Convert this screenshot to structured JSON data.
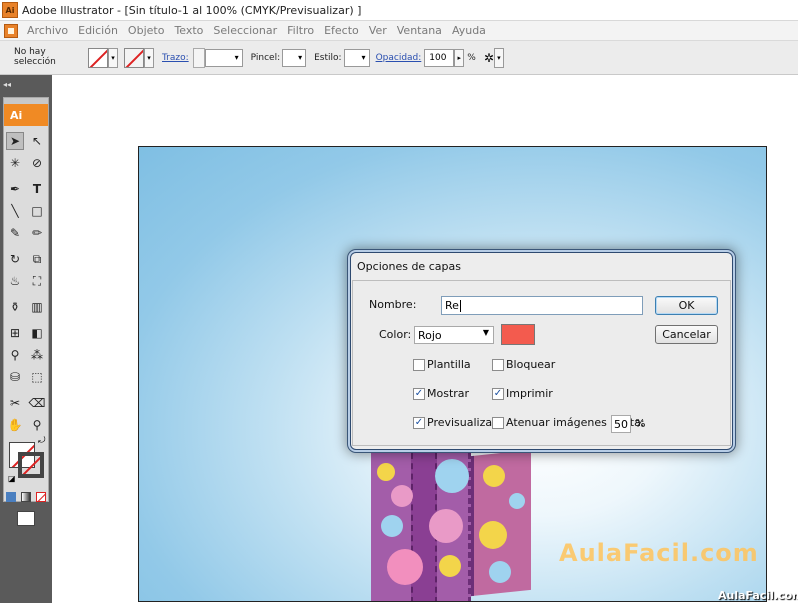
{
  "window": {
    "app_icon_text": "Ai",
    "title": "Adobe Illustrator - [Sin título-1 al 100% (CMYK/Previsualizar) ]"
  },
  "menu": [
    "Archivo",
    "Edición",
    "Objeto",
    "Texto",
    "Seleccionar",
    "Filtro",
    "Efecto",
    "Ver",
    "Ventana",
    "Ayuda"
  ],
  "control_bar": {
    "selection": "No hay selección",
    "trazo_label": "Trazo:",
    "pincel_label": "Pincel:",
    "estilo_label": "Estilo:",
    "opacidad_label": "Opacidad:",
    "opacidad_value": "100",
    "percent": "%"
  },
  "toolbox": {
    "logo": "Ai",
    "collapse": "◂◂"
  },
  "dialog": {
    "title": "Opciones de capas",
    "nombre_label": "Nombre:",
    "nombre_value": "Re",
    "color_label": "Color:",
    "color_value": "Rojo",
    "color_swatch": "#f35b4e",
    "ok": "OK",
    "cancel": "Cancelar",
    "options": {
      "plantilla": {
        "label": "Plantilla",
        "checked": false
      },
      "bloquear": {
        "label": "Bloquear",
        "checked": false
      },
      "mostrar": {
        "label": "Mostrar",
        "checked": true
      },
      "imprimir": {
        "label": "Imprimir",
        "checked": true
      },
      "previsualizar": {
        "label": "Previsualizar",
        "checked": true
      },
      "atenuar": {
        "label": "Atenuar imágenes hasta:",
        "checked": false
      }
    },
    "atenuar_value": "50",
    "atenuar_unit": "%"
  },
  "watermark": "AulaFacil.com",
  "footer_watermark": "AulaFacil.com"
}
